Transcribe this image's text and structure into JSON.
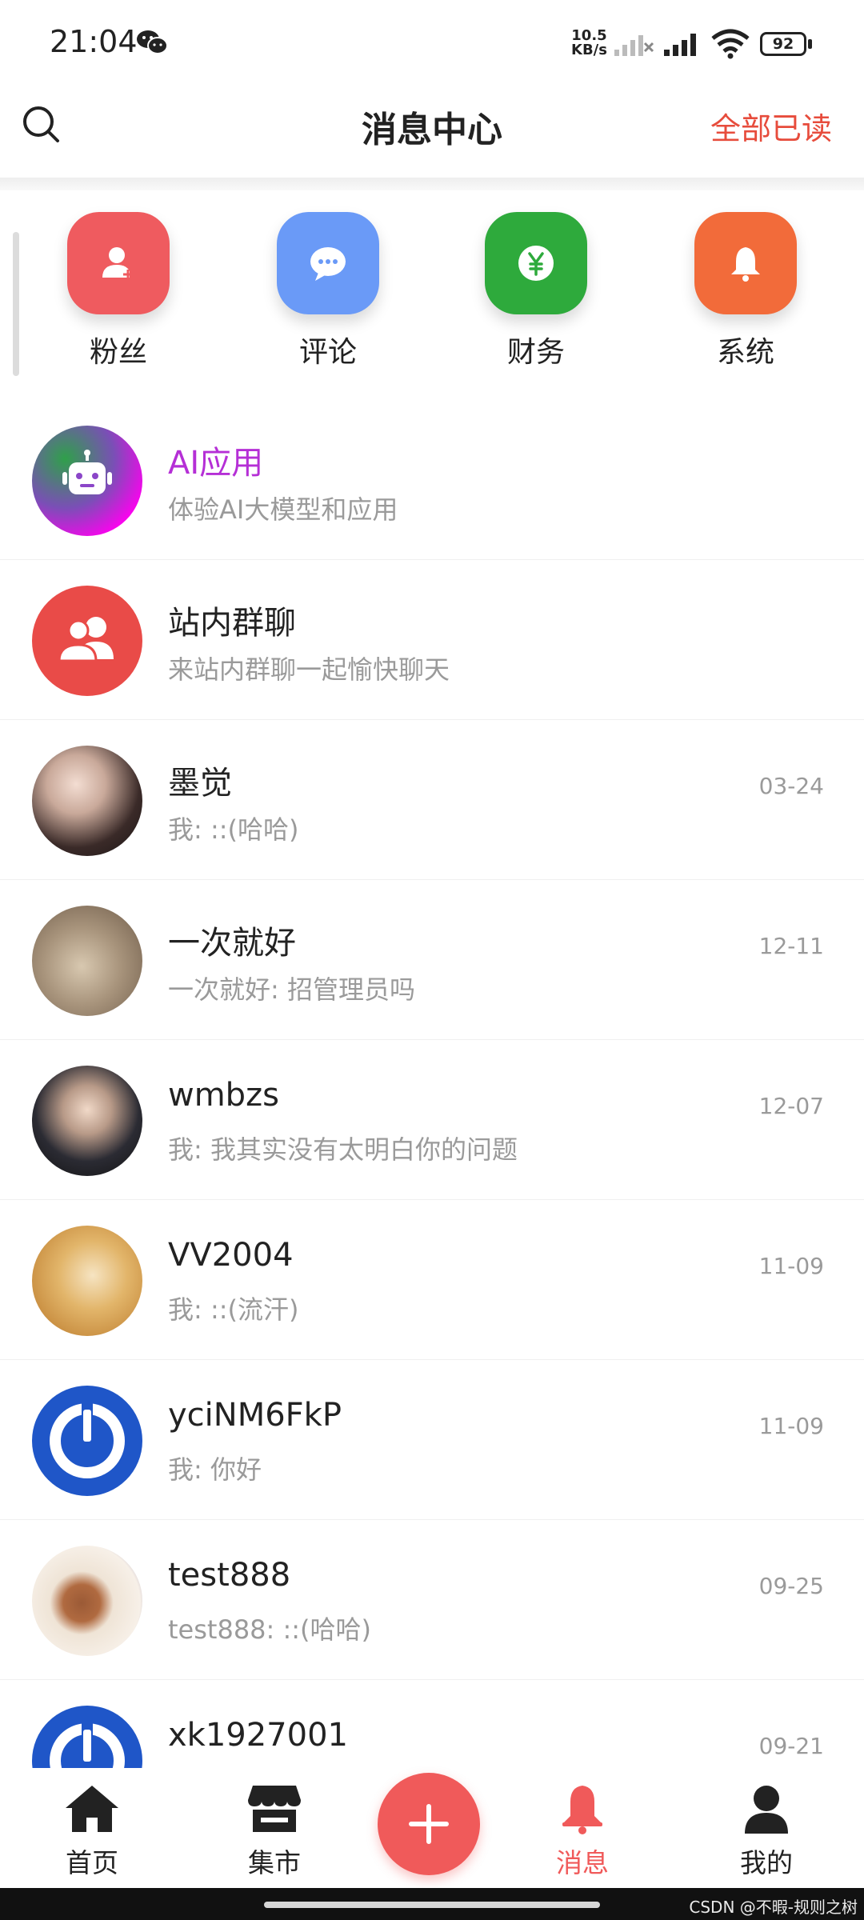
{
  "status_bar": {
    "time": "21:04",
    "net_speed_value": "10.5",
    "net_speed_unit": "KB/s",
    "battery": "92",
    "icons": [
      "wechat-icon",
      "signal-icon",
      "wifi-icon",
      "battery-icon"
    ]
  },
  "header": {
    "title": "消息中心",
    "mark_all_read": "全部已读"
  },
  "categories": [
    {
      "label": "粉丝",
      "icon": "user-add-icon",
      "color": "#ef5b5f"
    },
    {
      "label": "评论",
      "icon": "comment-icon",
      "color": "#6a9af7"
    },
    {
      "label": "财务",
      "icon": "yuan-icon",
      "color": "#2eaa3c"
    },
    {
      "label": "系统",
      "icon": "bell-icon",
      "color": "#f26b3a"
    }
  ],
  "conversations": [
    {
      "name": "AI应用",
      "preview": "体验AI大模型和应用",
      "time": "",
      "name_color": "#b52fd6"
    },
    {
      "name": "站内群聊",
      "preview": "来站内群聊一起愉快聊天",
      "time": ""
    },
    {
      "name": "墨觉",
      "preview": "我: ::(哈哈)",
      "time": "03-24"
    },
    {
      "name": "一次就好",
      "preview": "一次就好: 招管理员吗",
      "time": "12-11"
    },
    {
      "name": "wmbzs",
      "preview": "我: 我其实没有太明白你的问题",
      "time": "12-07"
    },
    {
      "name": "VV2004",
      "preview": "我: ::(流汗)",
      "time": "11-09"
    },
    {
      "name": "yciNM6FkP",
      "preview": "我: 你好",
      "time": "11-09"
    },
    {
      "name": "test888",
      "preview": "test888: ::(哈哈)",
      "time": "09-25"
    },
    {
      "name": "xk1927001",
      "preview": "",
      "time": "09-21"
    }
  ],
  "bottom_nav": [
    {
      "label": "首页",
      "icon": "home-icon"
    },
    {
      "label": "集市",
      "icon": "store-icon"
    },
    {
      "label": "消息",
      "icon": "bell-icon",
      "active": true
    },
    {
      "label": "我的",
      "icon": "user-icon"
    }
  ],
  "colors": {
    "accent": "#f05a5a",
    "mark_read": "#e74c3c"
  },
  "watermark": "CSDN @不暇-规则之树"
}
